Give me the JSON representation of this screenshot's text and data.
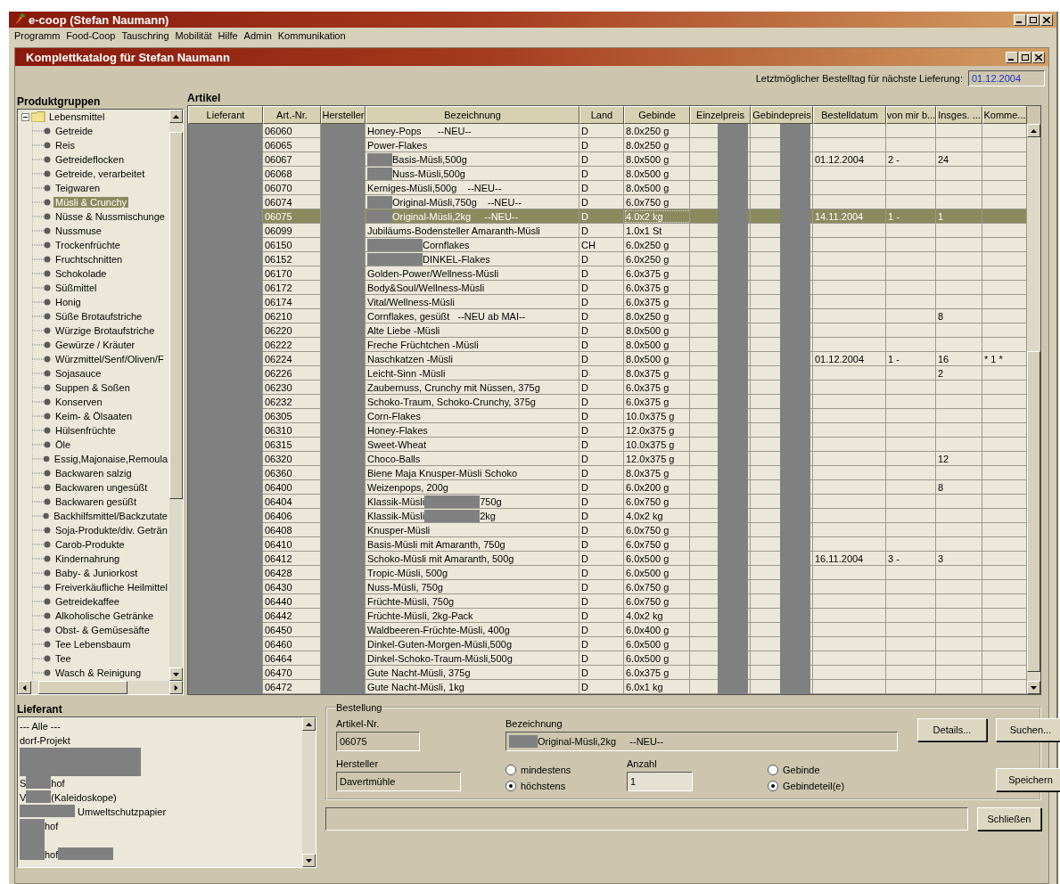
{
  "app_window": {
    "title": "e-coop (Stefan Naumann)"
  },
  "menu": [
    "Programm",
    "Food-Coop",
    "Tauschring",
    "Mobilität",
    "Hilfe",
    "Admin",
    "Kommunikation"
  ],
  "catalog_window": {
    "title": "Komplettkatalog für Stefan Naumann"
  },
  "deadline": {
    "label": "Letztmöglicher Bestelltag für nächste Lieferung:",
    "value": "01.12.2004"
  },
  "product_groups": {
    "title": "Produktgruppen",
    "tree": [
      {
        "label": "Lebensmittel",
        "expanded": true,
        "selected": false,
        "children": [
          {
            "label": "Getreide",
            "selected": false
          },
          {
            "label": "Reis",
            "selected": false
          },
          {
            "label": "Getreideflocken",
            "selected": false
          },
          {
            "label": "Getreide, verarbeitet",
            "selected": false
          },
          {
            "label": "Teigwaren",
            "selected": false
          },
          {
            "label": "Müsli & Crunchy",
            "selected": true
          },
          {
            "label": "Nüsse & Nussmischunge",
            "selected": false
          },
          {
            "label": "Nussmuse",
            "selected": false
          },
          {
            "label": "Trockenfrüchte",
            "selected": false
          },
          {
            "label": "Fruchtschnitten",
            "selected": false
          },
          {
            "label": "Schokolade",
            "selected": false
          },
          {
            "label": "Süßmittel",
            "selected": false
          },
          {
            "label": "Honig",
            "selected": false
          },
          {
            "label": "Süße Brotaufstriche",
            "selected": false
          },
          {
            "label": "Würzige Brotaufstriche",
            "selected": false
          },
          {
            "label": "Gewürze / Kräuter",
            "selected": false
          },
          {
            "label": "Würzmittel/Senf/Oliven/F",
            "selected": false
          },
          {
            "label": "Sojasauce",
            "selected": false
          },
          {
            "label": "Suppen & Soßen",
            "selected": false
          },
          {
            "label": "Konserven",
            "selected": false
          },
          {
            "label": "Keim- & Ölsaaten",
            "selected": false
          },
          {
            "label": "Hülsenfrüchte",
            "selected": false
          },
          {
            "label": "Öle",
            "selected": false
          },
          {
            "label": "Essig,Majonaise,Remoula",
            "selected": false
          },
          {
            "label": "Backwaren salzig",
            "selected": false
          },
          {
            "label": "Backwaren ungesüßt",
            "selected": false
          },
          {
            "label": "Backwaren gesüßt",
            "selected": false
          },
          {
            "label": "Backhilfsmittel/Backzutate",
            "selected": false
          },
          {
            "label": "Soja-Produkte/div. Geträn",
            "selected": false
          },
          {
            "label": "Carob-Produkte",
            "selected": false
          },
          {
            "label": "Kindernahrung",
            "selected": false
          },
          {
            "label": "Baby- & Juniorkost",
            "selected": false
          },
          {
            "label": "Freiverkäufliche Heilmittel",
            "selected": false
          },
          {
            "label": "Getreidekaffee",
            "selected": false
          },
          {
            "label": "Alkoholische Getränke",
            "selected": false
          },
          {
            "label": "Obst- & Gemüsesäfte",
            "selected": false
          },
          {
            "label": "Tee Lebensbaum",
            "selected": false
          },
          {
            "label": "Tee",
            "selected": false
          },
          {
            "label": "Wasch & Reinigung",
            "selected": false
          }
        ]
      }
    ]
  },
  "articles": {
    "title": "Artikel",
    "columns": [
      {
        "label": "Lieferant",
        "kind": "supplier"
      },
      {
        "label": "Art.-Nr.",
        "kind": "art_nr"
      },
      {
        "label": "Hersteller",
        "kind": "maker"
      },
      {
        "label": "Bezeichnung",
        "kind": "name"
      },
      {
        "label": "Land",
        "kind": "country"
      },
      {
        "label": "Gebinde",
        "kind": "pack"
      },
      {
        "label": "Einzelpreis",
        "kind": "unit_price"
      },
      {
        "label": "Gebindepreis",
        "kind": "pack_price"
      },
      {
        "label": "Bestelldatum",
        "kind": "date"
      },
      {
        "label": "von mir b...",
        "kind": "mine"
      },
      {
        "label": "Insges. ...",
        "kind": "total"
      },
      {
        "label": "Komme...",
        "kind": "comment"
      }
    ],
    "rows": [
      {
        "art_nr": "06060",
        "name": [
          {
            "kind": "text",
            "text": "Honey-Pops      --NEU--"
          }
        ],
        "country": "D",
        "pack": "8.0x250 g",
        "selected": false
      },
      {
        "art_nr": "06065",
        "name": [
          {
            "kind": "text",
            "text": "Power-Flakes"
          }
        ],
        "country": "D",
        "pack": "8.0x250 g",
        "selected": false
      },
      {
        "art_nr": "06067",
        "name": [
          {
            "kind": "redacted"
          },
          {
            "kind": "text",
            "text": "Basis-Müsli,500g"
          }
        ],
        "country": "D",
        "pack": "8.0x500 g",
        "date": "01.12.2004",
        "mine": "2 -",
        "total": "24",
        "selected": false
      },
      {
        "art_nr": "06068",
        "name": [
          {
            "kind": "redacted"
          },
          {
            "kind": "text",
            "text": "Nuss-Müsli,500g"
          }
        ],
        "country": "D",
        "pack": "8.0x500 g",
        "selected": false
      },
      {
        "art_nr": "06070",
        "name": [
          {
            "kind": "text",
            "text": "Kerniges-Müsli,500g    --NEU--"
          }
        ],
        "country": "D",
        "pack": "8.0x500 g",
        "selected": false
      },
      {
        "art_nr": "06074",
        "name": [
          {
            "kind": "redacted"
          },
          {
            "kind": "text",
            "text": "Original-Müsli,750g    --NEU--"
          }
        ],
        "country": "D",
        "pack": "6.0x750 g",
        "selected": false
      },
      {
        "art_nr": "06075",
        "name": [
          {
            "kind": "redacted"
          },
          {
            "kind": "text",
            "text": "Original-Müsli,2kg     --NEU--"
          }
        ],
        "country": "D",
        "pack": "4.0x2 kg",
        "date": "14.11.2004",
        "mine": "1 -",
        "total": "1",
        "selected": true
      },
      {
        "art_nr": "06099",
        "name": [
          {
            "kind": "text",
            "text": "Jubiläums-Bodensteller Amaranth-Müsli"
          }
        ],
        "country": "D",
        "pack": "1.0x1 St",
        "selected": false
      },
      {
        "art_nr": "06150",
        "name": [
          {
            "kind": "redacted",
            "wide": true
          },
          {
            "kind": "text",
            "text": "Cornflakes"
          }
        ],
        "country": "CH",
        "pack": "6.0x250 g",
        "selected": false
      },
      {
        "art_nr": "06152",
        "name": [
          {
            "kind": "redacted",
            "wide": true
          },
          {
            "kind": "text",
            "text": "DINKEL-Flakes"
          }
        ],
        "country": "D",
        "pack": "6.0x250 g",
        "selected": false
      },
      {
        "art_nr": "06170",
        "name": [
          {
            "kind": "text",
            "text": "Golden-Power/Wellness-Müsli"
          }
        ],
        "country": "D",
        "pack": "6.0x375 g",
        "selected": false
      },
      {
        "art_nr": "06172",
        "name": [
          {
            "kind": "text",
            "text": "Body&Soul/Wellness-Müsli"
          }
        ],
        "country": "D",
        "pack": "6.0x375 g",
        "selected": false
      },
      {
        "art_nr": "06174",
        "name": [
          {
            "kind": "text",
            "text": "Vital/Wellness-Müsli"
          }
        ],
        "country": "D",
        "pack": "6.0x375 g",
        "selected": false
      },
      {
        "art_nr": "06210",
        "name": [
          {
            "kind": "text",
            "text": "Cornflakes, gesüßt   --NEU ab MAI--"
          }
        ],
        "country": "D",
        "pack": "8.0x250 g",
        "total": "8",
        "selected": false
      },
      {
        "art_nr": "06220",
        "name": [
          {
            "kind": "text",
            "text": "Alte Liebe -Müsli"
          }
        ],
        "country": "D",
        "pack": "8.0x500 g",
        "selected": false
      },
      {
        "art_nr": "06222",
        "name": [
          {
            "kind": "text",
            "text": "Freche Früchtchen -Müsli"
          }
        ],
        "country": "D",
        "pack": "8.0x500 g",
        "selected": false
      },
      {
        "art_nr": "06224",
        "name": [
          {
            "kind": "text",
            "text": "Naschkatzen -Müsli"
          }
        ],
        "country": "D",
        "pack": "8.0x500 g",
        "date": "01.12.2004",
        "mine": "1 -",
        "total": "16",
        "comment": "* 1 *",
        "selected": false
      },
      {
        "art_nr": "06226",
        "name": [
          {
            "kind": "text",
            "text": "Leicht-Sinn -Müsli"
          }
        ],
        "country": "D",
        "pack": "8.0x375 g",
        "total": "2",
        "selected": false
      },
      {
        "art_nr": "06230",
        "name": [
          {
            "kind": "text",
            "text": "Zaubernuss, Crunchy mit Nüssen, 375g"
          }
        ],
        "country": "D",
        "pack": "6.0x375 g",
        "selected": false
      },
      {
        "art_nr": "06232",
        "name": [
          {
            "kind": "text",
            "text": "Schoko-Traum, Schoko-Crunchy, 375g"
          }
        ],
        "country": "D",
        "pack": "6.0x375 g",
        "selected": false
      },
      {
        "art_nr": "06305",
        "name": [
          {
            "kind": "text",
            "text": "Corn-Flakes"
          }
        ],
        "country": "D",
        "pack": "10.0x375 g",
        "selected": false
      },
      {
        "art_nr": "06310",
        "name": [
          {
            "kind": "text",
            "text": "Honey-Flakes"
          }
        ],
        "country": "D",
        "pack": "12.0x375 g",
        "selected": false
      },
      {
        "art_nr": "06315",
        "name": [
          {
            "kind": "text",
            "text": "Sweet-Wheat"
          }
        ],
        "country": "D",
        "pack": "10.0x375 g",
        "selected": false
      },
      {
        "art_nr": "06320",
        "name": [
          {
            "kind": "text",
            "text": "Choco-Balls"
          }
        ],
        "country": "D",
        "pack": "12.0x375 g",
        "total": "12",
        "selected": false
      },
      {
        "art_nr": "06360",
        "name": [
          {
            "kind": "text",
            "text": "Biene Maja Knusper-Müsli Schoko"
          }
        ],
        "country": "D",
        "pack": "8.0x375 g",
        "selected": false
      },
      {
        "art_nr": "06400",
        "name": [
          {
            "kind": "text",
            "text": "Weizenpops, 200g"
          }
        ],
        "country": "D",
        "pack": "6.0x200 g",
        "total": "8",
        "selected": false
      },
      {
        "art_nr": "06404",
        "name": [
          {
            "kind": "text",
            "text": "Klassik-Müsli"
          },
          {
            "kind": "redacted",
            "wide": true
          },
          {
            "kind": "text",
            "text": "750g"
          }
        ],
        "country": "D",
        "pack": "6.0x750 g",
        "selected": false
      },
      {
        "art_nr": "06406",
        "name": [
          {
            "kind": "text",
            "text": "Klassik-Müsli"
          },
          {
            "kind": "redacted",
            "wide": true
          },
          {
            "kind": "text",
            "text": "2kg"
          }
        ],
        "country": "D",
        "pack": "4.0x2 kg",
        "selected": false
      },
      {
        "art_nr": "06408",
        "name": [
          {
            "kind": "text",
            "text": "Knusper-Müsli"
          }
        ],
        "country": "D",
        "pack": "6.0x750 g",
        "selected": false
      },
      {
        "art_nr": "06410",
        "name": [
          {
            "kind": "text",
            "text": "Basis-Müsli mit Amaranth, 750g"
          }
        ],
        "country": "D",
        "pack": "6.0x750 g",
        "selected": false
      },
      {
        "art_nr": "06412",
        "name": [
          {
            "kind": "text",
            "text": "Schoko-Müsli mit Amaranth, 500g"
          }
        ],
        "country": "D",
        "pack": "6.0x500 g",
        "date": "16.11.2004",
        "mine": "3 -",
        "total": "3",
        "selected": false
      },
      {
        "art_nr": "06428",
        "name": [
          {
            "kind": "text",
            "text": "Tropic-Müsli, 500g"
          }
        ],
        "country": "D",
        "pack": "6.0x500 g",
        "selected": false
      },
      {
        "art_nr": "06430",
        "name": [
          {
            "kind": "text",
            "text": "Nuss-Müsli, 750g"
          }
        ],
        "country": "D",
        "pack": "6.0x750 g",
        "selected": false
      },
      {
        "art_nr": "06440",
        "name": [
          {
            "kind": "text",
            "text": "Früchte-Müsli, 750g"
          }
        ],
        "country": "D",
        "pack": "6.0x750 g",
        "selected": false
      },
      {
        "art_nr": "06442",
        "name": [
          {
            "kind": "text",
            "text": "Früchte-Müsli, 2kg-Pack"
          }
        ],
        "country": "D",
        "pack": "4.0x2 kg",
        "selected": false
      },
      {
        "art_nr": "06450",
        "name": [
          {
            "kind": "text",
            "text": "Waldbeeren-Früchte-Müsli, 400g"
          }
        ],
        "country": "D",
        "pack": "6.0x400 g",
        "selected": false
      },
      {
        "art_nr": "06460",
        "name": [
          {
            "kind": "text",
            "text": "Dinkel-Guten-Morgen-Müsli,500g"
          }
        ],
        "country": "D",
        "pack": "6.0x500 g",
        "selected": false
      },
      {
        "art_nr": "06464",
        "name": [
          {
            "kind": "text",
            "text": "Dinkel-Schoko-Traum-Müsli,500g"
          }
        ],
        "country": "D",
        "pack": "6.0x500 g",
        "selected": false
      },
      {
        "art_nr": "06470",
        "name": [
          {
            "kind": "text",
            "text": "Gute Nacht-Müsli, 375g"
          }
        ],
        "country": "D",
        "pack": "6.0x375 g",
        "selected": false
      },
      {
        "art_nr": "06472",
        "name": [
          {
            "kind": "text",
            "text": "Gute Nacht-Müsli, 1kg"
          }
        ],
        "country": "D",
        "pack": "6.0x1 kg",
        "selected": false
      }
    ]
  },
  "suppliers": {
    "title": "Lieferant",
    "items": [
      {
        "parts": [
          {
            "kind": "text",
            "text": "--- Alle ---"
          }
        ]
      },
      {
        "parts": [
          {
            "kind": "text",
            "text": "dorf-Projekt"
          }
        ]
      },
      {
        "parts": [
          {
            "kind": "redacted",
            "tall": true,
            "wide": true
          }
        ]
      },
      {
        "parts": [
          {
            "kind": "text",
            "text": "S"
          },
          {
            "kind": "redacted"
          },
          {
            "kind": "text",
            "text": "hof"
          }
        ]
      },
      {
        "parts": [
          {
            "kind": "text",
            "text": "V"
          },
          {
            "kind": "redacted"
          },
          {
            "kind": "text",
            "text": "(Kaleidoskope)"
          }
        ]
      },
      {
        "parts": [
          {
            "kind": "redacted",
            "wide": true
          },
          {
            "kind": "text",
            "text": " Umweltschutzpapier"
          }
        ]
      },
      {
        "parts": [
          {
            "kind": "redacted",
            "tall": true
          },
          {
            "kind": "text",
            "text": "hof"
          }
        ]
      },
      {
        "parts": [
          {
            "kind": "redacted"
          },
          {
            "kind": "text",
            "text": "hof"
          },
          {
            "kind": "redacted",
            "wide": true
          }
        ]
      }
    ]
  },
  "order": {
    "title": "Bestellung",
    "art_nr": {
      "label": "Artikel-Nr.",
      "value": "06075"
    },
    "name": {
      "label": "Bezeichnung",
      "value": "Original-Müsli,2kg     --NEU--"
    },
    "maker": {
      "label": "Hersteller",
      "value": "Davertmühle"
    },
    "quantity_mode": [
      {
        "label": "mindestens",
        "selected": false
      },
      {
        "label": "höchstens",
        "selected": true
      }
    ],
    "amount": {
      "label": "Anzahl",
      "value": "1"
    },
    "unit_mode": [
      {
        "label": "Gebinde",
        "selected": false
      },
      {
        "label": "Gebindeteil(e)",
        "selected": true
      }
    ],
    "buttons": {
      "details": "Details...",
      "search": "Suchen...",
      "save": "Speichern"
    }
  },
  "close_button": "Schließen"
}
